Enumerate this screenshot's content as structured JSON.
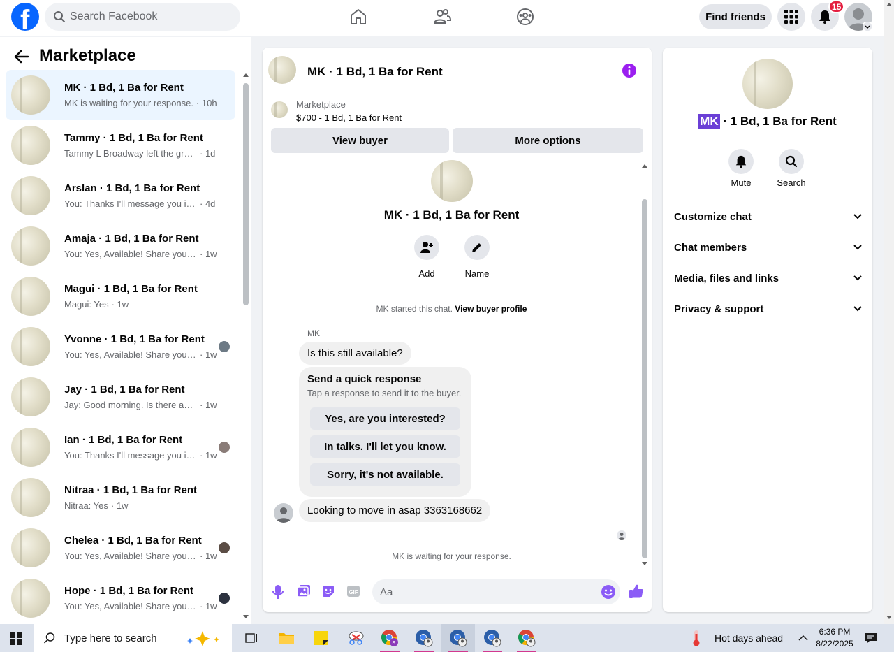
{
  "topbar": {
    "search_placeholder": "Search Facebook",
    "find_friends": "Find friends",
    "notification_count": "15"
  },
  "left": {
    "title": "Marketplace",
    "conversations": [
      {
        "name": "MK · 1 Bd, 1 Ba for Rent",
        "msg": "MK is waiting for your response.",
        "time": "· 10h"
      },
      {
        "name": "Tammy · 1 Bd, 1 Ba for Rent",
        "msg": "Tammy L Broadway left the group.",
        "time": "· 1d"
      },
      {
        "name": "Arslan · 1 Bd, 1 Ba for Rent",
        "msg": "You: Thanks I'll message you in a m...",
        "time": "· 4d"
      },
      {
        "name": "Amaja · 1 Bd, 1 Ba for Rent",
        "msg": "You: Yes, Available! Share your nu...",
        "time": "· 1w"
      },
      {
        "name": "Magui · 1 Bd, 1 Ba for Rent",
        "msg": "Magui: Yes",
        "time": "· 1w"
      },
      {
        "name": "Yvonne · 1 Bd, 1 Ba for Rent",
        "msg": "You: Yes, Available! Share your n...",
        "time": "· 1w"
      },
      {
        "name": "Jay · 1 Bd, 1 Ba for Rent",
        "msg": "Jay: Good morning. Is there anywa...",
        "time": "· 1w"
      },
      {
        "name": "Ian · 1 Bd, 1 Ba for Rent",
        "msg": "You: Thanks I'll message you in ...",
        "time": "· 1w"
      },
      {
        "name": "Nitraa · 1 Bd, 1 Ba for Rent",
        "msg": "Nitraa: Yes",
        "time": "· 1w"
      },
      {
        "name": "Chelea · 1 Bd, 1 Ba for Rent",
        "msg": "You: Yes, Available! Share your n...",
        "time": "· 1w"
      },
      {
        "name": "Hope · 1 Bd, 1 Ba for Rent",
        "msg": "You: Yes, Available! Share your n...",
        "time": "· 1w"
      }
    ]
  },
  "chat": {
    "title": "MK · 1 Bd, 1 Ba for Rent",
    "marketplace_label": "Marketplace",
    "listing": "$700 - 1 Bd, 1 Ba for Rent",
    "view_buyer": "View buyer",
    "more_options": "More options",
    "profile_name": "MK · 1 Bd, 1 Ba for Rent",
    "add_label": "Add",
    "name_label": "Name",
    "started_text": "MK started this chat.",
    "view_buyer_profile": "View buyer profile",
    "sender": "MK",
    "msg1": "Is this still available?",
    "quick_title": "Send a quick response",
    "quick_sub": "Tap a response to send it to the buyer.",
    "quick_responses": [
      "Yes, are you interested?",
      "In talks. I'll let you know.",
      "Sorry, it's not available."
    ],
    "msg2": "Looking to move in asap 3363168662",
    "waiting": "MK is waiting for your response.",
    "input_placeholder": "Aa"
  },
  "right": {
    "title_highlight": "MK",
    "title_rest": " · 1 Bd, 1 Ba for Rent",
    "mute": "Mute",
    "search": "Search",
    "sections": [
      "Customize chat",
      "Chat members",
      "Media, files and links",
      "Privacy & support"
    ]
  },
  "taskbar": {
    "search_placeholder": "Type here to search",
    "weather": "Hot days ahead",
    "time": "6:36 PM",
    "date": "8/22/2025"
  }
}
